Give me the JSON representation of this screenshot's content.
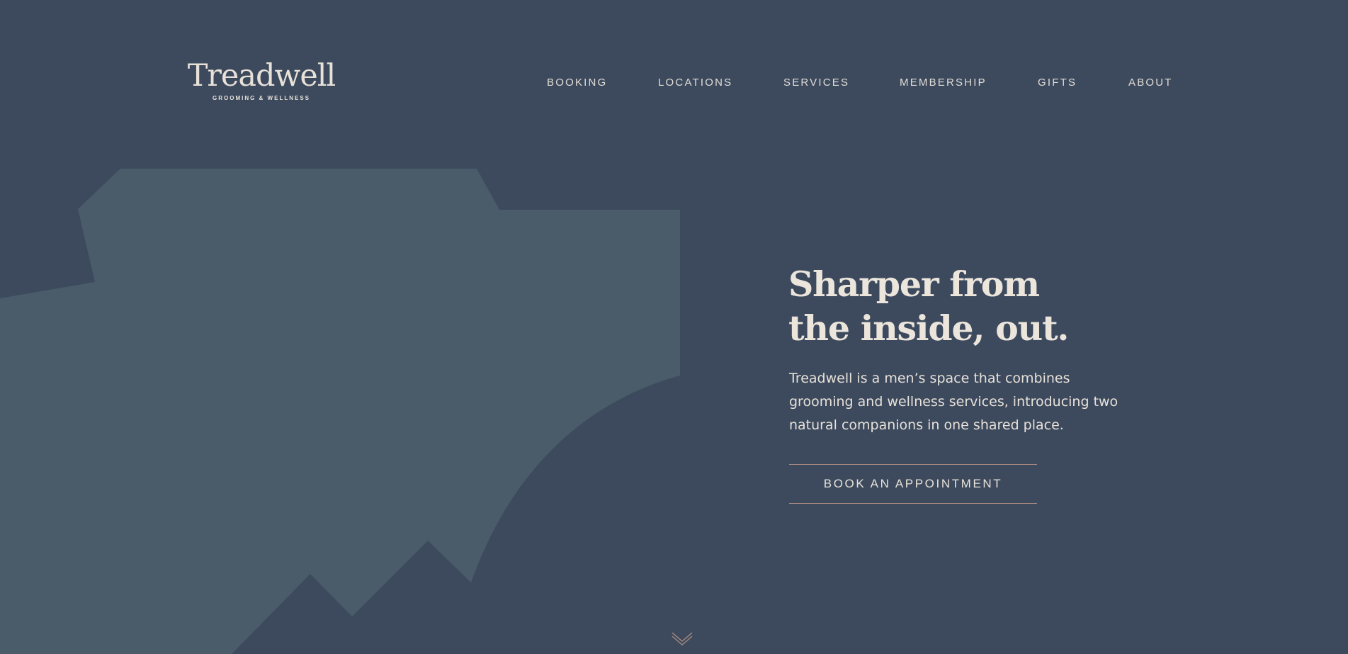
{
  "brand": {
    "name": "Treadwell",
    "tagline": "GROOMING & WELLNESS"
  },
  "nav": {
    "items": [
      "BOOKING",
      "LOCATIONS",
      "SERVICES",
      "MEMBERSHIP",
      "GIFTS",
      "ABOUT"
    ]
  },
  "hero": {
    "title_lines": [
      "Sharper from",
      "the inside, out."
    ],
    "description_lines": [
      "Treadwell is a men’s space that combines",
      "grooming and wellness services, introducing two",
      "natural companions in one shared place."
    ],
    "cta_label": "BOOK AN APPOINTMENT"
  },
  "icons": {
    "scroll": "chevron-double-down-icon"
  },
  "colors": {
    "background": "#3d4a5e",
    "shape": "#4a5b6a",
    "text": "#e7e1d8",
    "accent": "#a88a7f"
  }
}
